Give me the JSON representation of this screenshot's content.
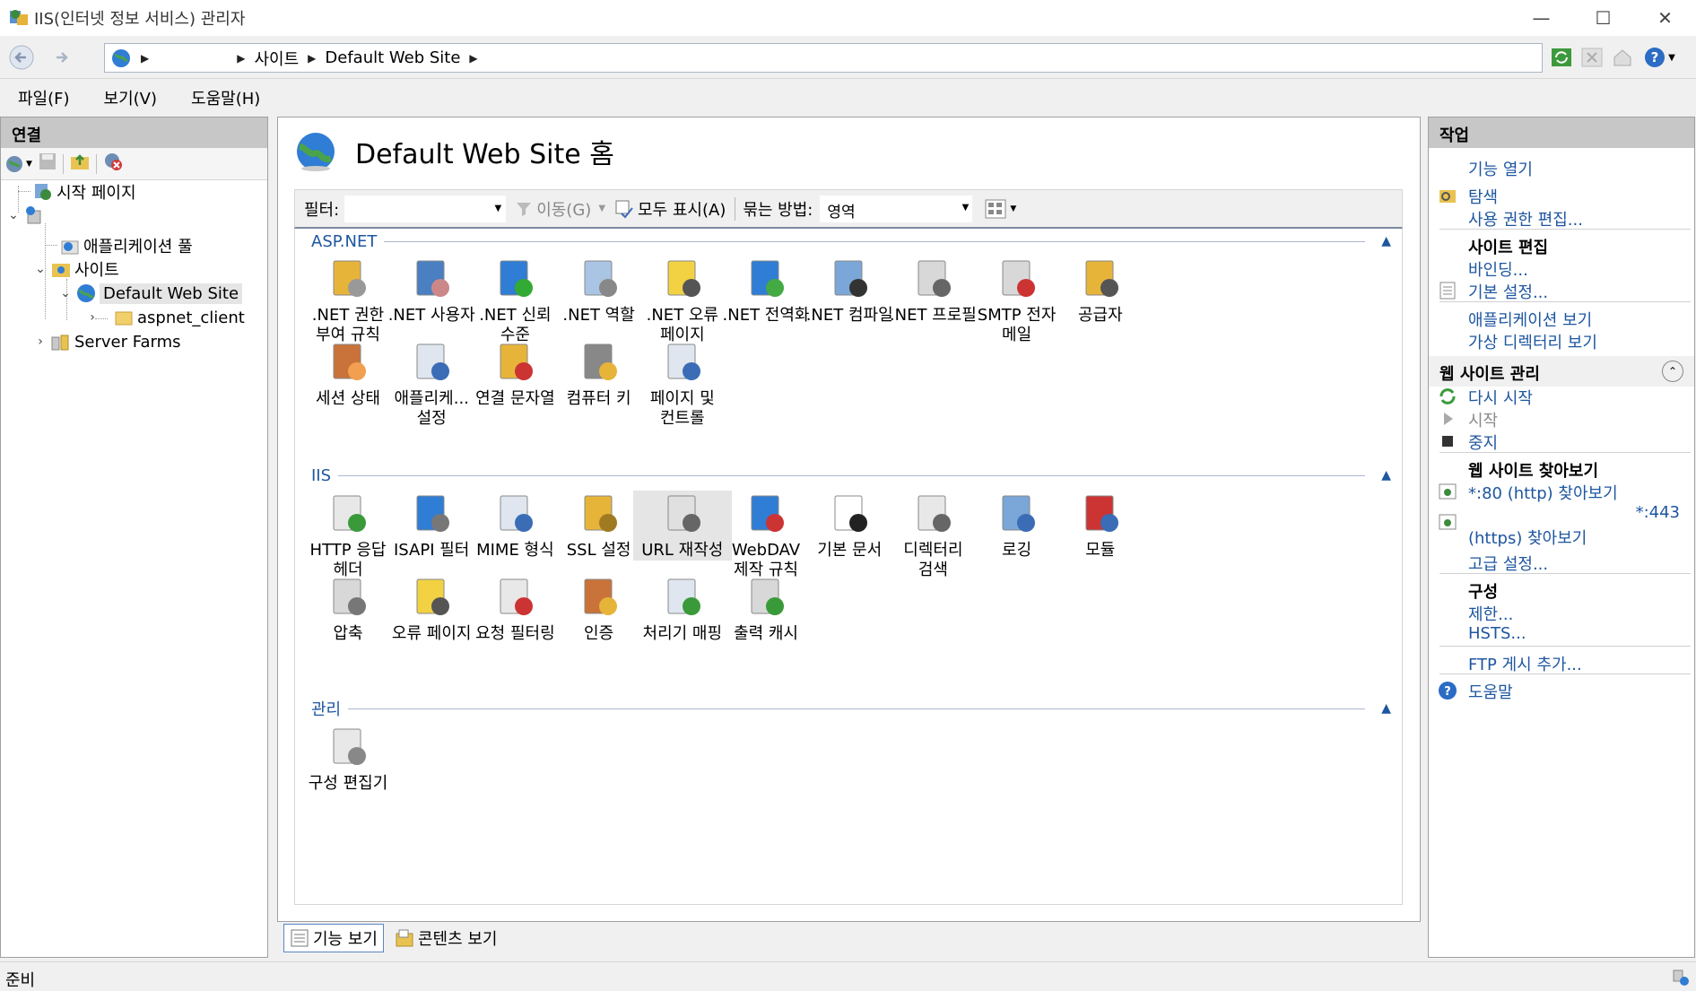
{
  "window": {
    "title": "IIS(인터넷 정보 서비스) 관리자"
  },
  "address": {
    "crumbs": [
      "사이트",
      "Default Web Site"
    ]
  },
  "menu": [
    "파일(F)",
    "보기(V)",
    "도움말(H)"
  ],
  "connections": {
    "header": "연결",
    "tree": {
      "start_page": "시작 페이지",
      "app_pools": "애플리케이션 풀",
      "sites": "사이트",
      "default_site": "Default Web Site",
      "aspnet_client": "aspnet_client",
      "server_farms": "Server Farms"
    }
  },
  "center": {
    "title": "Default Web Site 홈",
    "filter_label": "필터:",
    "filter_value": "",
    "go_label": "이동(G)",
    "show_all_label": "모두 표시(A)",
    "group_by_label": "묶는 방법:",
    "group_by_value": "영역",
    "sections": {
      "aspnet": "ASP.NET",
      "iis": "IIS",
      "management": "관리"
    },
    "aspnet_features": [
      {
        "line1": ".NET 권한",
        "line2": "부여 규칙"
      },
      {
        "line1": ".NET 사용자",
        "line2": ""
      },
      {
        "line1": ".NET 신뢰",
        "line2": "수준"
      },
      {
        "line1": ".NET 역할",
        "line2": ""
      },
      {
        "line1": ".NET 오류",
        "line2": "페이지"
      },
      {
        "line1": ".NET 전역화",
        "line2": ""
      },
      {
        "line1": ".NET 컴파일",
        "line2": ""
      },
      {
        "line1": ".NET 프로필",
        "line2": ""
      },
      {
        "line1": "SMTP 전자",
        "line2": "메일"
      },
      {
        "line1": "공급자",
        "line2": ""
      },
      {
        "line1": "세션 상태",
        "line2": ""
      },
      {
        "line1": "애플리케...",
        "line2": "설정"
      },
      {
        "line1": "연결 문자열",
        "line2": ""
      },
      {
        "line1": "컴퓨터 키",
        "line2": ""
      },
      {
        "line1": "페이지 및",
        "line2": "컨트롤"
      }
    ],
    "iis_features": [
      {
        "line1": "HTTP 응답",
        "line2": "헤더"
      },
      {
        "line1": "ISAPI 필터",
        "line2": ""
      },
      {
        "line1": "MIME 형식",
        "line2": ""
      },
      {
        "line1": "SSL 설정",
        "line2": ""
      },
      {
        "line1": "URL 재작성",
        "line2": ""
      },
      {
        "line1": "WebDAV",
        "line2": "제작 규칙"
      },
      {
        "line1": "기본 문서",
        "line2": ""
      },
      {
        "line1": "디렉터리",
        "line2": "검색"
      },
      {
        "line1": "로깅",
        "line2": ""
      },
      {
        "line1": "모듈",
        "line2": ""
      },
      {
        "line1": "압축",
        "line2": ""
      },
      {
        "line1": "오류 페이지",
        "line2": ""
      },
      {
        "line1": "요청 필터링",
        "line2": ""
      },
      {
        "line1": "인증",
        "line2": ""
      },
      {
        "line1": "처리기 매핑",
        "line2": ""
      },
      {
        "line1": "출력 캐시",
        "line2": ""
      }
    ],
    "mgmt_features": [
      {
        "line1": "구성 편집기",
        "line2": ""
      }
    ],
    "view_tabs": {
      "features": "기능 보기",
      "content": "콘텐츠 보기"
    }
  },
  "actions": {
    "header": "작업",
    "open_feature": "기능 열기",
    "explore": "탐색",
    "edit_permissions": "사용 권한 편집...",
    "edit_site": "사이트 편집",
    "bindings": "바인딩...",
    "basic_settings": "기본 설정...",
    "view_apps": "애플리케이션 보기",
    "view_vdirs": "가상 디렉터리 보기",
    "manage_site": "웹 사이트 관리",
    "restart": "다시 시작",
    "start": "시작",
    "stop": "중지",
    "browse_site": "웹 사이트 찾아보기",
    "browse_http": "*:80 (http) 찾아보기",
    "browse_https_1": "*:443",
    "browse_https_2": "(https) 찾아보기",
    "advanced": "고급 설정...",
    "configure": "구성",
    "limits": "제한...",
    "hsts": "HSTS...",
    "ftp": "FTP 게시 추가...",
    "help": "도움말"
  },
  "status": {
    "text": "준비"
  },
  "colors": {
    "link": "#1e56a0",
    "panel_header": "#c7c7c7",
    "disabled": "#8a8a8a"
  }
}
